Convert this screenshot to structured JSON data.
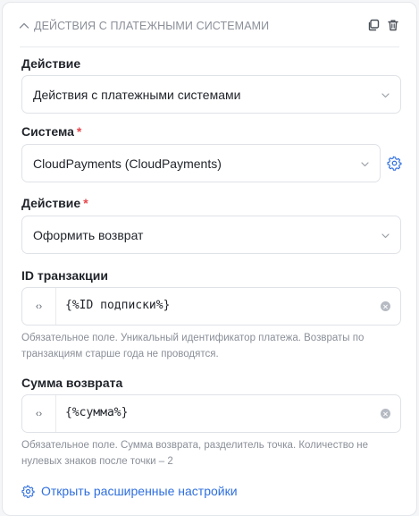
{
  "header": {
    "title": "ДЕЙСТВИЯ С ПЛАТЕЖНЫМИ СИСТЕМАМИ"
  },
  "fields": {
    "action_main": {
      "label": "Действие",
      "value": "Действия с платежными системами"
    },
    "system": {
      "label": "Система",
      "required_mark": "*",
      "value": "CloudPayments (CloudPayments)"
    },
    "action": {
      "label": "Действие",
      "required_mark": "*",
      "value": "Оформить возврат"
    },
    "transaction_id": {
      "label": "ID транзакции",
      "prefix": "‹›",
      "value": "{%ID подписки%}",
      "hint": "Обязательное поле. Уникальный идентификатор платежа. Возвраты по транзакциям старше года не проводятся."
    },
    "refund_amount": {
      "label": "Сумма возврата",
      "prefix": "‹›",
      "value": "{%сумма%}",
      "hint": "Обязательное поле. Сумма возврата, разделитель точка. Количество не нулевых знаков после точки – 2"
    }
  },
  "advanced_link": {
    "label": "Открыть расширенные настройки"
  },
  "colors": {
    "accent": "#2f6fdf",
    "required": "#e5484d",
    "muted": "#8a8f98",
    "border": "#dfe2e7"
  }
}
